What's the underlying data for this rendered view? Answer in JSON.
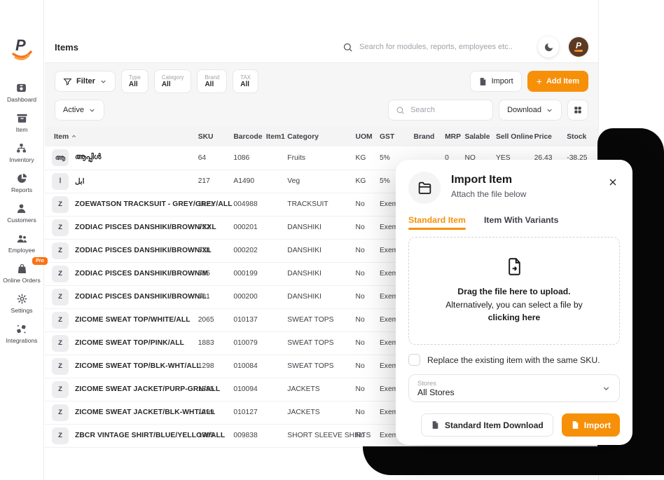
{
  "colors": {
    "accent": "#F79009",
    "pro_badge": "#F97316",
    "backdrop": "#070707",
    "avatar_bg": "#5C3A21"
  },
  "sidebar": {
    "pro_badge": "Pro",
    "items": [
      {
        "label": "Dashboard"
      },
      {
        "label": "Item"
      },
      {
        "label": "Inventory"
      },
      {
        "label": "Reports"
      },
      {
        "label": "Customers"
      },
      {
        "label": "Employee"
      },
      {
        "label": "Online Orders"
      },
      {
        "label": "Settings"
      },
      {
        "label": "Integrations"
      }
    ]
  },
  "header": {
    "title": "Items",
    "search_placeholder": "Search for modules, reports, employees etc..",
    "avatar_text": "P"
  },
  "toolbar": {
    "filter_label": "Filter",
    "chips": [
      {
        "label": "Type",
        "value": "All"
      },
      {
        "label": "Category",
        "value": "All"
      },
      {
        "label": "Brand",
        "value": "All"
      },
      {
        "label": "TAX",
        "value": "All"
      }
    ],
    "import_label": "Import",
    "add_item_label": "Add Item",
    "status_filter": "Active",
    "search_placeholder": "Search",
    "download_label": "Download"
  },
  "table": {
    "columns": [
      "Item",
      "SKU",
      "Barcode",
      "Item1",
      "Category",
      "UOM",
      "GST",
      "Brand",
      "MRP",
      "Salable",
      "Sell Online",
      "Price",
      "Stock"
    ],
    "rows": [
      {
        "avatar": "ആ",
        "name": "ആപ്പിൾ",
        "sku": "64",
        "barcode": "1086",
        "item1": "",
        "category": "Fruits",
        "uom": "KG",
        "gst": "5%",
        "brand": "",
        "mrp": "0",
        "salable": "NO",
        "sell_online": "YES",
        "price": "26.43",
        "stock": "-38.25"
      },
      {
        "avatar": "ا",
        "name": "ابل",
        "sku": "217",
        "barcode": "A1490",
        "item1": "",
        "category": "Veg",
        "uom": "KG",
        "gst": "5%",
        "brand": "",
        "mrp": "",
        "salable": "",
        "sell_online": "",
        "price": "",
        "stock": ""
      },
      {
        "avatar": "Z",
        "name": "ZOEWATSON TRACKSUIT - GREY/GREY/ALL",
        "sku": "1621",
        "barcode": "004988",
        "item1": "",
        "category": "TRACKSUIT",
        "uom": "No",
        "gst": "Exempted",
        "brand": "",
        "mrp": "",
        "salable": "",
        "sell_online": "",
        "price": "",
        "stock": ""
      },
      {
        "avatar": "Z",
        "name": "ZODIAC PISCES DANSHIKI/BROWN/XXL",
        "sku": "752",
        "barcode": "000201",
        "item1": "",
        "category": "DANSHIKI",
        "uom": "No",
        "gst": "Exempted",
        "brand": "",
        "mrp": "",
        "salable": "",
        "sell_online": "",
        "price": "",
        "stock": ""
      },
      {
        "avatar": "Z",
        "name": "ZODIAC PISCES DANSHIKI/BROWN/XL",
        "sku": "628",
        "barcode": "000202",
        "item1": "",
        "category": "DANSHIKI",
        "uom": "No",
        "gst": "Exempted",
        "brand": "",
        "mrp": "",
        "salable": "",
        "sell_online": "",
        "price": "",
        "stock": ""
      },
      {
        "avatar": "Z",
        "name": "ZODIAC PISCES DANSHIKI/BROWN/M",
        "sku": "685",
        "barcode": "000199",
        "item1": "",
        "category": "DANSHIKI",
        "uom": "No",
        "gst": "Exempted",
        "brand": "",
        "mrp": "",
        "salable": "",
        "sell_online": "",
        "price": "",
        "stock": ""
      },
      {
        "avatar": "Z",
        "name": "ZODIAC PISCES DANSHIKI/BROWN/L",
        "sku": "581",
        "barcode": "000200",
        "item1": "",
        "category": "DANSHIKI",
        "uom": "No",
        "gst": "Exempted",
        "brand": "",
        "mrp": "",
        "salable": "",
        "sell_online": "",
        "price": "",
        "stock": ""
      },
      {
        "avatar": "Z",
        "name": "ZICOME SWEAT TOP/WHITE/ALL",
        "sku": "2065",
        "barcode": "010137",
        "item1": "",
        "category": "SWEAT TOPS",
        "uom": "No",
        "gst": "Exempted",
        "brand": "",
        "mrp": "",
        "salable": "",
        "sell_online": "",
        "price": "",
        "stock": ""
      },
      {
        "avatar": "Z",
        "name": "ZICOME SWEAT TOP/PINK/ALL",
        "sku": "1883",
        "barcode": "010079",
        "item1": "",
        "category": "SWEAT TOPS",
        "uom": "No",
        "gst": "Exempted",
        "brand": "",
        "mrp": "",
        "salable": "",
        "sell_online": "",
        "price": "",
        "stock": ""
      },
      {
        "avatar": "Z",
        "name": "ZICOME SWEAT TOP/BLK-WHT/ALL",
        "sku": "1298",
        "barcode": "010084",
        "item1": "",
        "category": "SWEAT TOPS",
        "uom": "No",
        "gst": "Exempted",
        "brand": "",
        "mrp": "",
        "salable": "",
        "sell_online": "",
        "price": "",
        "stock": ""
      },
      {
        "avatar": "Z",
        "name": "ZICOME SWEAT JACKET/PURP-GRN/ALL",
        "sku": "1885",
        "barcode": "010094",
        "item1": "",
        "category": "JACKETS",
        "uom": "No",
        "gst": "Exempted",
        "brand": "",
        "mrp": "",
        "salable": "",
        "sell_online": "",
        "price": "",
        "stock": ""
      },
      {
        "avatar": "Z",
        "name": "ZICOME SWEAT JACKET/BLK-WHT/ALL",
        "sku": "1299",
        "barcode": "010127",
        "item1": "",
        "category": "JACKETS",
        "uom": "No",
        "gst": "Exempted",
        "brand": "",
        "mrp": "",
        "salable": "",
        "sell_online": "",
        "price": "",
        "stock": ""
      },
      {
        "avatar": "Z",
        "name": "ZBCR VINTAGE SHIRT/BLUE/YELLOW/ALL",
        "sku": "1395",
        "barcode": "009838",
        "item1": "",
        "category": "SHORT SLEEVE SHIRTS",
        "uom": "No",
        "gst": "Exempted",
        "brand": "",
        "mrp": "",
        "salable": "",
        "sell_online": "",
        "price": "",
        "stock": ""
      }
    ]
  },
  "modal": {
    "title": "Import Item",
    "subtitle": "Attach the file below",
    "tabs": [
      {
        "label": "Standard Item"
      },
      {
        "label": "Item With Variants"
      }
    ],
    "dropzone_line1": "Drag the file here to upload.",
    "dropzone_line2": "Alternatively, you can select a file by",
    "dropzone_line3": "clicking here",
    "checkbox_label": "Replace the existing item with the same SKU.",
    "stores_label": "Stores",
    "stores_value": "All Stores",
    "download_button": "Standard Item Download",
    "import_button": "Import"
  }
}
